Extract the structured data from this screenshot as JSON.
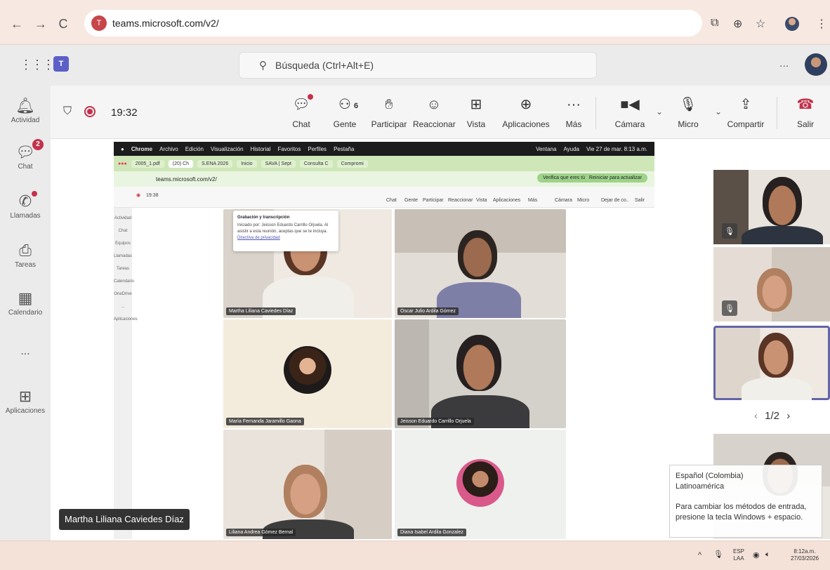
{
  "browser": {
    "url": "teams.microsoft.com/v2/",
    "site_icon": "T"
  },
  "teams": {
    "search_placeholder": "Búsqueda (Ctrl+Alt+E)",
    "more": "...",
    "logo": "T"
  },
  "rail": {
    "items": [
      {
        "label": "Actividad"
      },
      {
        "label": "Chat",
        "badge": "2"
      },
      {
        "label": "Llamadas"
      },
      {
        "label": "Tareas"
      },
      {
        "label": "Calendario"
      },
      {
        "label": "..."
      },
      {
        "label": "Aplicaciones"
      }
    ]
  },
  "meeting": {
    "time": "19:32",
    "people_count": "6",
    "toolbar": {
      "chat": "Chat",
      "people": "Gente",
      "raise": "Participar",
      "react": "Reaccionar",
      "view": "Vista",
      "apps": "Aplicaciones",
      "more": "Más",
      "camera": "Cámara",
      "mic": "Micro",
      "share": "Compartir",
      "leave": "Salir"
    },
    "presenter_name": "Martha Liliana Caviedes Díaz"
  },
  "shared_screen": {
    "mac_menu": [
      "Chrome",
      "Archivo",
      "Edición",
      "Visualización",
      "Historial",
      "Favoritos",
      "Perfiles",
      "Pestaña"
    ],
    "mac_menu_right": [
      "Ventana",
      "Ayuda",
      "Vie 27 de mar. 8:13 a.m."
    ],
    "tabs": [
      "2005_1.pdf",
      "(20) Ch",
      "S.ENA 2026",
      "Inicio",
      "SAVA | Sept",
      "Consulta C",
      "Compromi"
    ],
    "address": "teams.microsoft.com/v2/",
    "verify_label": "Verifica que eres tú",
    "update_label": "Reiniciar para actualizar",
    "inner_time": "19:38",
    "inner_toolbar": [
      "Chat",
      "Gente",
      "Participar",
      "Reaccionar",
      "Vista",
      "Aplicaciones",
      "Más",
      "Cámara",
      "Micro",
      "Dejar de co..",
      "Salir"
    ],
    "inner_rail": [
      "Actividad",
      "Chat",
      "Equipos",
      "Llamadas",
      "Tareas",
      "Calendario",
      "OneDrive",
      "OneDrive",
      "...",
      "Aplicaciones"
    ],
    "rec_notice": {
      "title": "Grabación y transcripción",
      "body": "Iniciado por: Jeisson Eduardo Carrillo Orjuela. Al asistir a esta reunión, aceptas que se te incluya.",
      "link": "Directiva de privacidad"
    },
    "tiles": [
      {
        "name": "Martha Liliana Caviedes Díaz"
      },
      {
        "name": "Oscar Julio Ardila Gómez"
      },
      {
        "name": "María Fernanda Jaramillo Gaona"
      },
      {
        "name": "Jeisson Eduardo Carrillo Orjuela"
      },
      {
        "name": "Liliana Andrea Gómez Bernal"
      },
      {
        "name": "Diana Isabel Ardila Gonzalez"
      }
    ]
  },
  "gallery": {
    "pager": "1/2"
  },
  "lang_popup": {
    "line1": "Español (Colombia)",
    "line2": "Latinoamérica",
    "line3": "Para cambiar los métodos de entrada,",
    "line4": "presione la tecla Windows + espacio."
  },
  "taskbar": {
    "lang": "ESP",
    "layout": "LAA",
    "time": "8:12a.m.",
    "date": "27/03/2026"
  }
}
